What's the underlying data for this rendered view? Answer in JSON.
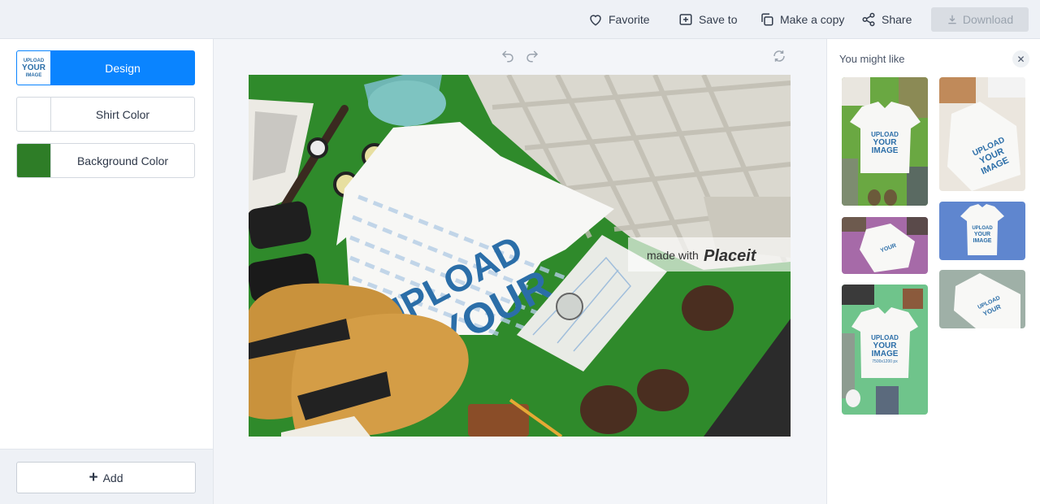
{
  "toolbar": {
    "favorite_label": "Favorite",
    "save_label": "Save to",
    "copy_label": "Make a copy",
    "share_label": "Share",
    "download_label": "Download"
  },
  "sidebar": {
    "options": [
      {
        "label": "Design",
        "swatch": "upload-your-image"
      },
      {
        "label": "Shirt Color",
        "swatch": "#ffffff"
      },
      {
        "label": "Background Color",
        "swatch": "#2e7d27"
      }
    ],
    "design_swatch": {
      "line1": "UPLOAD",
      "line2": "YOUR",
      "line3": "IMAGE"
    },
    "add_label": "Add"
  },
  "canvas": {
    "shirt_text": [
      "UPLOAD",
      "YOUR"
    ],
    "watermark_prefix": "made with",
    "watermark_brand": "Placeit"
  },
  "right_panel": {
    "title": "You might like",
    "thumb_text": [
      "UPLOAD",
      "YOUR",
      "IMAGE",
      "7500x1200 px"
    ],
    "thumbnails": [
      {
        "bg": "#6aa842",
        "name": "green flat lay shirt"
      },
      {
        "bg": "#e9e4dc",
        "name": "beige flat lay shirt"
      },
      {
        "bg": "#a66aa8",
        "name": "purple flat lay shirt"
      },
      {
        "bg": "#5f86cf",
        "name": "blue background shirt"
      },
      {
        "bg": "#6fc48b",
        "name": "mint flat lay shirt"
      },
      {
        "bg": "#9fb0a7",
        "name": "grey-green background shirt"
      }
    ]
  },
  "colors": {
    "accent": "#0a84ff",
    "background_color": "#2e7d27",
    "shirt_text": "#2b6ea8"
  }
}
